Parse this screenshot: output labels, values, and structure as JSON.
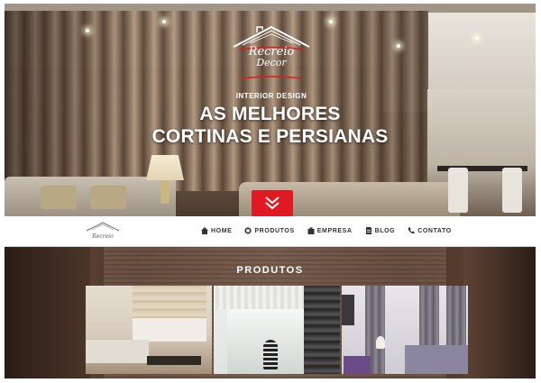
{
  "brand": {
    "name": "Recreio",
    "sub": "Decor",
    "tagline": "INTERIOR DESIGN"
  },
  "hero": {
    "headline_line1": "AS MELHORES",
    "headline_line2": "CORTINAS E PERSIANAS",
    "scroll_button_icon": "chevron-double-down-icon",
    "accent_color": "#e01a22"
  },
  "nav": {
    "items": [
      {
        "label": "HOME",
        "icon": "home-icon"
      },
      {
        "label": "PRODUTOS",
        "icon": "grid-icon"
      },
      {
        "label": "EMPRESA",
        "icon": "building-icon"
      },
      {
        "label": "BLOG",
        "icon": "document-icon"
      },
      {
        "label": "CONTATO",
        "icon": "phone-icon"
      }
    ]
  },
  "products": {
    "title": "PRODUTOS",
    "thumbnails": [
      {
        "icon": "roman-blinds-image"
      },
      {
        "icon": "roller-honeycomb-blinds-image"
      },
      {
        "icon": "curtains-image"
      }
    ]
  }
}
